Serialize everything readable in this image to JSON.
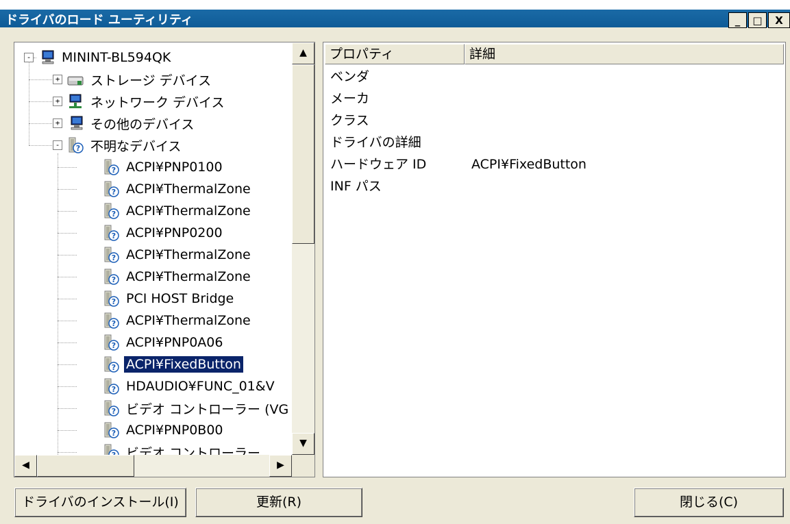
{
  "window": {
    "title": "ドライバのロード ユーティリティ",
    "min_label": "_",
    "max_label": "□",
    "close_label": "X"
  },
  "tree": {
    "root": {
      "label": "MININT-BL594QK",
      "expander": "-"
    },
    "categories": [
      {
        "label": "ストレージ デバイス",
        "expander": "+",
        "icon": "storage-device-icon"
      },
      {
        "label": "ネットワーク デバイス",
        "expander": "+",
        "icon": "network-device-icon"
      },
      {
        "label": "その他のデバイス",
        "expander": "+",
        "icon": "other-device-icon"
      },
      {
        "label": "不明なデバイス",
        "expander": "-",
        "icon": "unknown-device-icon"
      }
    ],
    "unknown_devices": [
      "ACPI¥PNP0100",
      "ACPI¥ThermalZone",
      "ACPI¥ThermalZone",
      "ACPI¥PNP0200",
      "ACPI¥ThermalZone",
      "ACPI¥ThermalZone",
      "PCI HOST Bridge",
      "ACPI¥ThermalZone",
      "ACPI¥PNP0A06",
      "ACPI¥FixedButton",
      "HDAUDIO¥FUNC_01&V",
      "ビデオ コントローラー (VG",
      "ACPI¥PNP0B00",
      "ビデオ コントローラー"
    ],
    "selected_index": 9,
    "scroll_up": "▲",
    "scroll_down": "▼",
    "scroll_left": "◀",
    "scroll_right": "▶"
  },
  "properties": {
    "headers": [
      "プロパティ",
      "詳細"
    ],
    "rows": [
      {
        "name": "ベンダ",
        "value": ""
      },
      {
        "name": "メーカ",
        "value": ""
      },
      {
        "name": "クラス",
        "value": ""
      },
      {
        "name": "ドライバの詳細",
        "value": ""
      },
      {
        "name": "ハードウェア ID",
        "value": "ACPI¥FixedButton"
      },
      {
        "name": "INF パス",
        "value": ""
      }
    ]
  },
  "buttons": {
    "install": "ドライバのインストール(I)",
    "refresh": "更新(R)",
    "close": "閉じる(C)"
  }
}
